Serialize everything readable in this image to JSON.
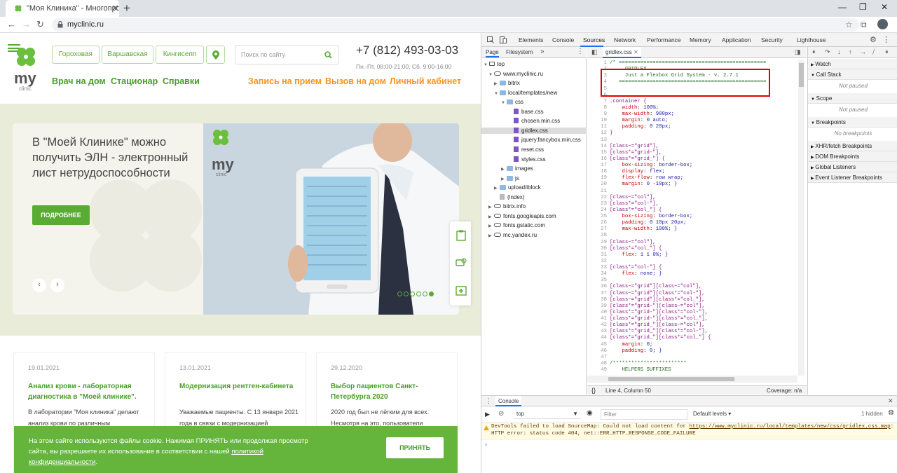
{
  "browser": {
    "tab_title": "\"Моя Клиника\" - Многопрофи",
    "url": "myclinic.ru"
  },
  "site": {
    "locations": [
      "Гороховая",
      "Варшавская",
      "Кингисепп"
    ],
    "search_placeholder": "Поиск по сайту",
    "phone": "+7 (812) 493-03-03",
    "hours": "Пн.-Пт. 08:00-21:00, Сб. 9:00-16:00",
    "nav_left": [
      "Врач на дом",
      "Стационар",
      "Справки"
    ],
    "nav_right": [
      "Запись на прием",
      "Вызов на дом",
      "Личный кабинет"
    ],
    "logo_text": "my",
    "logo_sub": "clinic",
    "hero": {
      "text": "В \"Моей Клинике\" можно получить ЭЛН - электронный лист нетрудоспособности",
      "button": "ПОДРОБНЕЕ"
    },
    "news": [
      {
        "date": "19.01.2021",
        "title": "Анализ крови - лабораторная диагностика в \"Моей клинике\".",
        "body": "В лаборатории \"Моя клиника\" делают анализ крови по различным"
      },
      {
        "date": "13.01.2021",
        "title": "Модернизация рентген-кабинета",
        "body": "Уважаемые пациенты. С 13 января 2021 года в связи с модернизацией"
      },
      {
        "date": "29.12.2020",
        "title": "Выбор пациентов Санкт-Петербурга 2020",
        "body": "2020 год был не лёгким для всех. Несмотря на это, пользователи"
      }
    ],
    "cookie": {
      "text": "На этом сайте используются файлы cookie. Нажимая ПРИНЯТЬ или продолжая просмотр сайта, вы разрешаете их использование в соответствии с нашей",
      "link": "политикой конфиденциальности",
      "button": "ПРИНЯТЬ"
    }
  },
  "devtools": {
    "tabs": [
      "Elements",
      "Console",
      "Sources",
      "Network",
      "Performance",
      "Memory",
      "Application",
      "Security",
      "Lighthouse"
    ],
    "active_tab": "Sources",
    "navigator_tabs": [
      "Page",
      "Filesystem"
    ],
    "tree": [
      {
        "label": "top",
        "level": 0,
        "kind": "frame"
      },
      {
        "label": "www.myclinic.ru",
        "level": 1,
        "kind": "cloud"
      },
      {
        "label": "bitrix",
        "level": 2,
        "kind": "folder"
      },
      {
        "label": "local/templates/new",
        "level": 2,
        "kind": "folder"
      },
      {
        "label": "css",
        "level": 3,
        "kind": "folder"
      },
      {
        "label": "base.css",
        "level": 4,
        "kind": "file"
      },
      {
        "label": "chosen.min.css",
        "level": 4,
        "kind": "file"
      },
      {
        "label": "gridlex.css",
        "level": 4,
        "kind": "file",
        "selected": true
      },
      {
        "label": "jquery.fancybox.min.css",
        "level": 4,
        "kind": "file"
      },
      {
        "label": "reset.css",
        "level": 4,
        "kind": "file"
      },
      {
        "label": "styles.css",
        "level": 4,
        "kind": "file"
      },
      {
        "label": "images",
        "level": 3,
        "kind": "folder"
      },
      {
        "label": "js",
        "level": 3,
        "kind": "folder"
      },
      {
        "label": "upload/iblock",
        "level": 2,
        "kind": "folder"
      },
      {
        "label": "(index)",
        "level": 2,
        "kind": "file-plain"
      },
      {
        "label": "bitrix.info",
        "level": 1,
        "kind": "cloud"
      },
      {
        "label": "fonts.googleapis.com",
        "level": 1,
        "kind": "cloud"
      },
      {
        "label": "fonts.gstatic.com",
        "level": 1,
        "kind": "cloud"
      },
      {
        "label": "mc.yandex.ru",
        "level": 1,
        "kind": "cloud"
      }
    ],
    "editor_tab": "gridlex.css",
    "code_lines": [
      "/* ================================================",
      "     GRIDLEX",
      "     Just a Flexbox Grid System - v. 2.7.1",
      "   ================================================",
      "",
      "",
      ".container {",
      "    width: 100%;",
      "    max-width: 980px;",
      "    margin: 0 auto;",
      "    padding: 0 20px;",
      "}",
      "",
      "[class~=\"grid\"],",
      "[class*=\"grid-\"],",
      "[class*=\"grid_\"] {",
      "    box-sizing: border-box;",
      "    display: flex;",
      "    flex-flow: row wrap;",
      "    margin: 0 -10px; }",
      "",
      "[class~=\"col\"],",
      "[class*=\"col-\"],",
      "[class*=\"col_\"] {",
      "    box-sizing: border-box;",
      "    padding: 0 10px 20px;",
      "    max-width: 100%; }",
      "",
      "[class~=\"col\"],",
      "[class*=\"col_\"] {",
      "    flex: 1 1 0%; }",
      "",
      "[class*=\"col-\"] {",
      "    flex: none; }",
      "",
      "[class~=\"grid\"][class~=\"col\"],",
      "[class~=\"grid\"][class*=\"col-\"],",
      "[class~=\"grid\"][class*=\"col_\"],",
      "[class*=\"grid-\"][class~=\"col\"],",
      "[class*=\"grid-\"][class*=\"col-\"],",
      "[class*=\"grid-\"][class*=\"col_\"],",
      "[class*=\"grid_\"][class~=\"col\"],",
      "[class*=\"grid_\"][class*=\"col-\"],",
      "[class*=\"grid_\"][class*=\"col_\"] {",
      "    margin: 0;",
      "    padding: 0; }",
      "",
      "/************************",
      "    HELPERS SUFFIXES"
    ],
    "status": "Line 4, Column 50",
    "coverage": "Coverage: n/a",
    "debugger_sections": [
      {
        "label": "Watch"
      },
      {
        "label": "Call Stack",
        "note": "Not paused"
      },
      {
        "label": "Scope",
        "note": "Not paused"
      },
      {
        "label": "Breakpoints",
        "note": "No breakpoints"
      },
      {
        "label": "XHR/fetch Breakpoints"
      },
      {
        "label": "DOM Breakpoints"
      },
      {
        "label": "Global Listeners"
      },
      {
        "label": "Event Listener Breakpoints"
      }
    ],
    "console": {
      "tab": "Console",
      "context": "top",
      "filter_placeholder": "Filter",
      "levels": "Default levels",
      "hidden": "1 hidden",
      "warning_prefix": "DevTools failed to load SourceMap: Could not load content for ",
      "warning_url": "https://www.myclinic.ru/local/templates/new/css/gridlex.css.map",
      "warning_suffix": ": HTTP error: status code 404, net::ERR_HTTP_RESPONSE_CODE_FAILURE"
    }
  },
  "colors": {
    "brand_green": "#5aab33",
    "brand_orange": "#f7931e",
    "highlight_red": "#e00000",
    "devtools_blue": "#1a73e8"
  }
}
